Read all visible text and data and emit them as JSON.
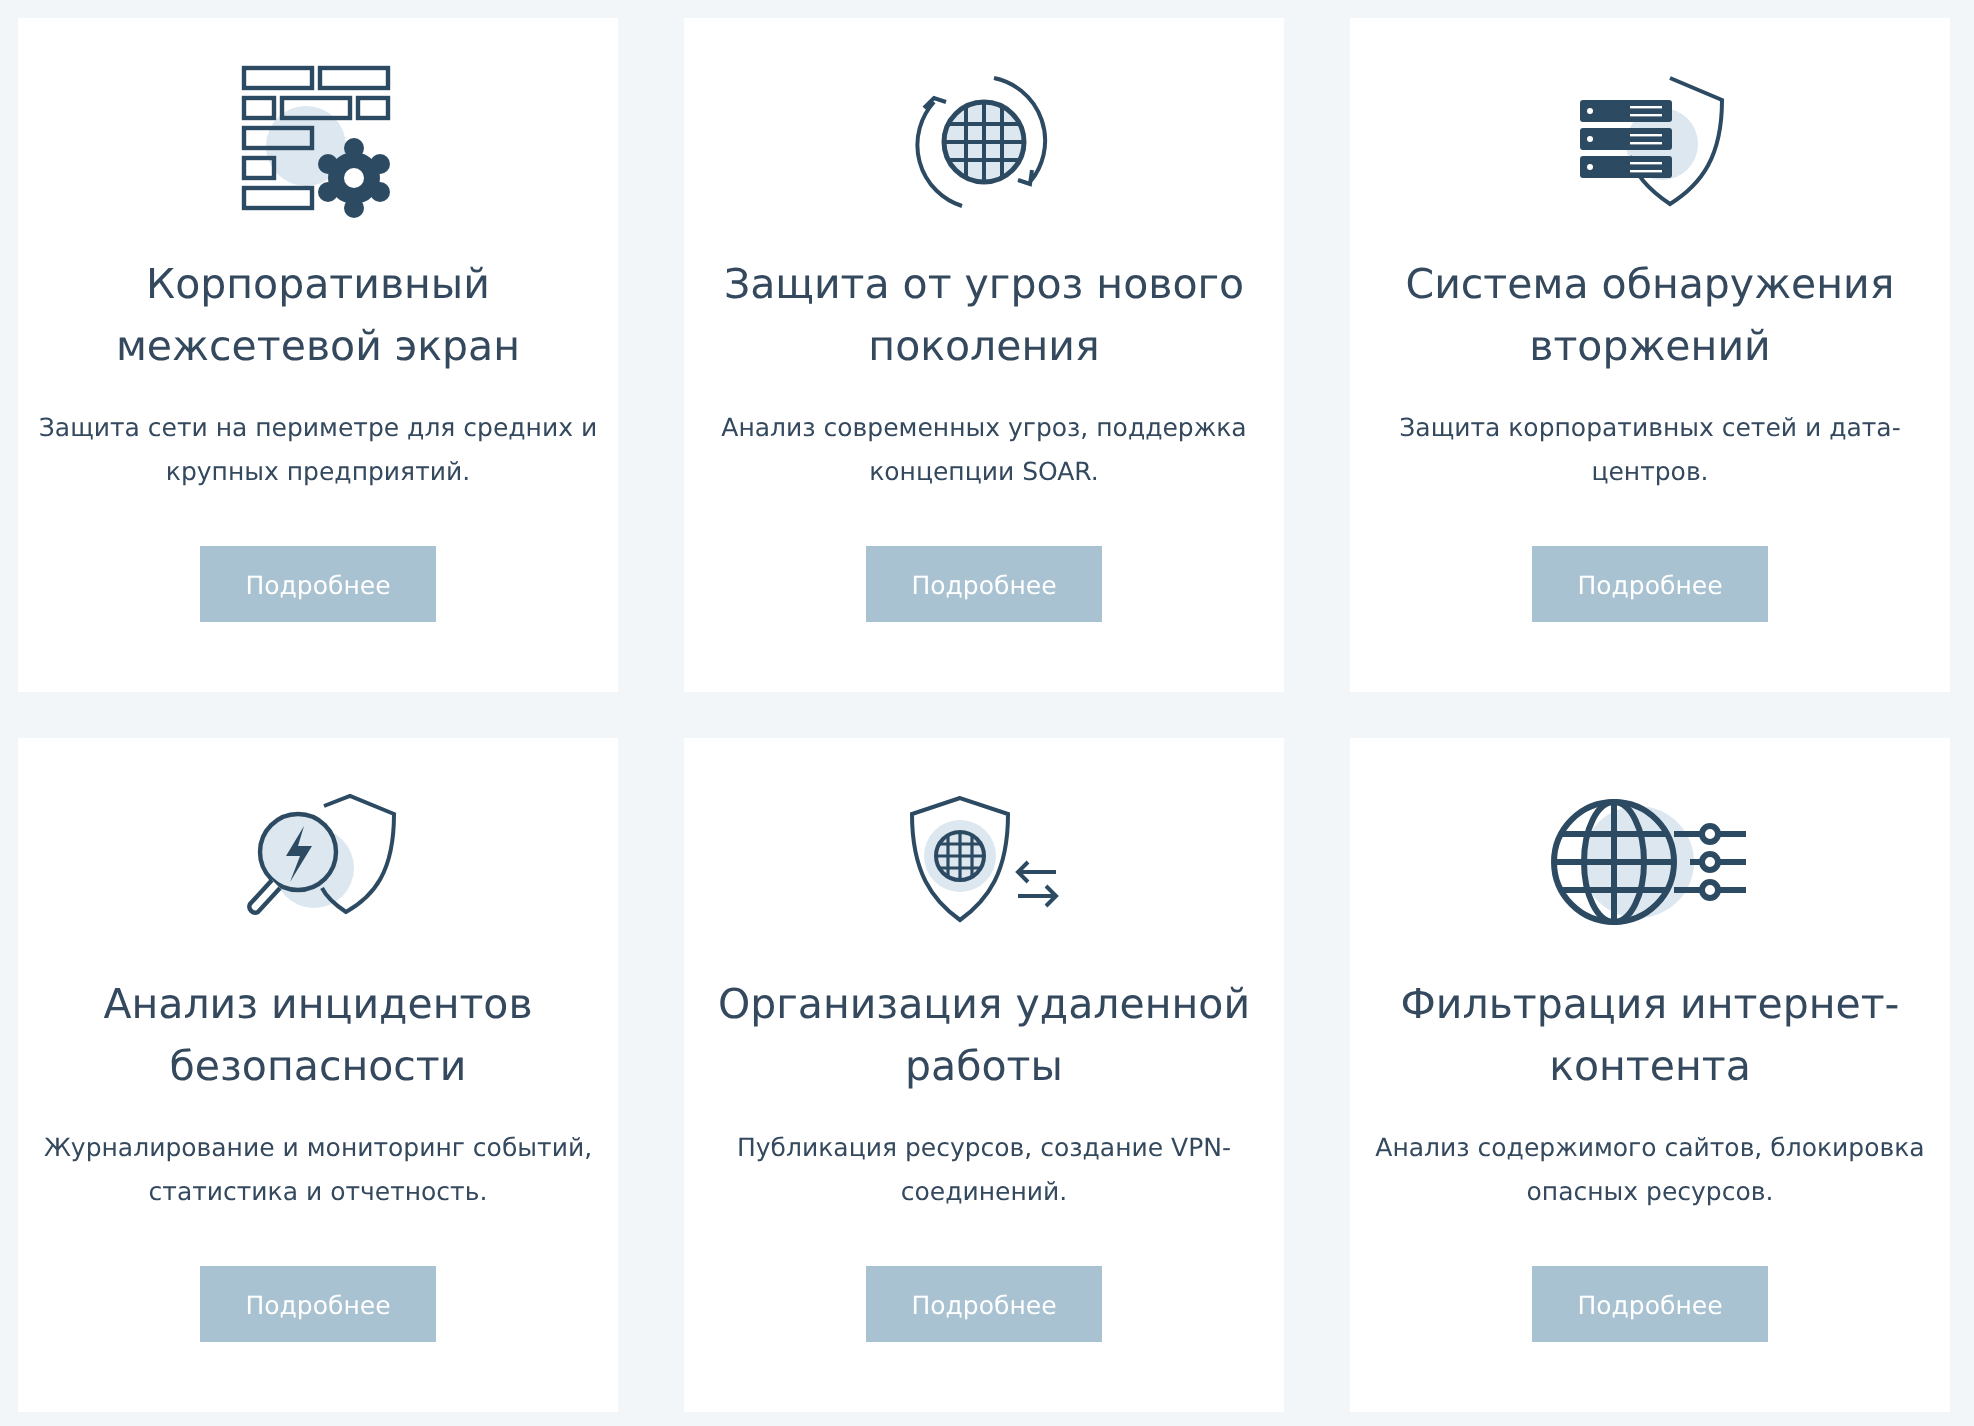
{
  "cards": [
    {
      "title": "Корпоративный межсетевой экран",
      "description": "Защита сети на периметре для средних и крупных предприятий.",
      "button": "Подробнее"
    },
    {
      "title": "Защита от угроз нового поколения",
      "description": "Анализ современных угроз, поддержка концепции SOAR.",
      "button": "Подробнее"
    },
    {
      "title": "Система обнаружения вторжений",
      "description": "Защита корпоративных сетей и дата-центров.",
      "button": "Подробнее"
    },
    {
      "title": "Анализ инцидентов безопасности",
      "description": "Журналирование и мониторинг событий, статистика и отчетность.",
      "button": "Подробнее"
    },
    {
      "title": "Организация удаленной работы",
      "description": "Публикация ресурсов, создание VPN-соединений.",
      "button": "Подробнее"
    },
    {
      "title": "Фильтрация интернет-контента",
      "description": "Анализ содержимого сайтов, блокировка опасных ресурсов.",
      "button": "Подробнее"
    }
  ]
}
